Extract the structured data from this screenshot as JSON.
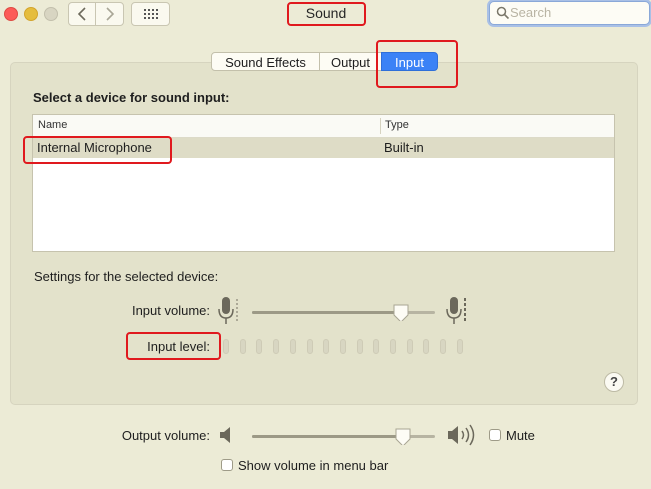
{
  "window": {
    "title": "Sound",
    "search_placeholder": "Search"
  },
  "toolbar": {
    "back_icon": "chevron-left-icon",
    "forward_icon": "chevron-right-icon",
    "grid_icon": "grid-icon"
  },
  "tabs": [
    {
      "label": "Sound Effects",
      "selected": false
    },
    {
      "label": "Output",
      "selected": false
    },
    {
      "label": "Input",
      "selected": true
    }
  ],
  "input_panel": {
    "section_title": "Select a device for sound input:",
    "columns": [
      "Name",
      "Type"
    ],
    "devices": [
      {
        "name": "Internal Microphone",
        "type": "Built-in",
        "selected": true
      }
    ],
    "settings_title": "Settings for the selected device:",
    "input_volume_label": "Input volume:",
    "input_volume_value": 0.85,
    "input_level_label": "Input level:",
    "input_level_value": 0,
    "help_label": "?"
  },
  "output": {
    "volume_label": "Output volume:",
    "volume_value": 0.86,
    "mute_label": "Mute",
    "mute_checked": false,
    "show_in_menubar_label": "Show volume in menu bar",
    "show_in_menubar_checked": false
  },
  "colors": {
    "accent": "#3b82f6",
    "window_bg": "#ecebd6",
    "highlight_box": "#e0191e"
  }
}
